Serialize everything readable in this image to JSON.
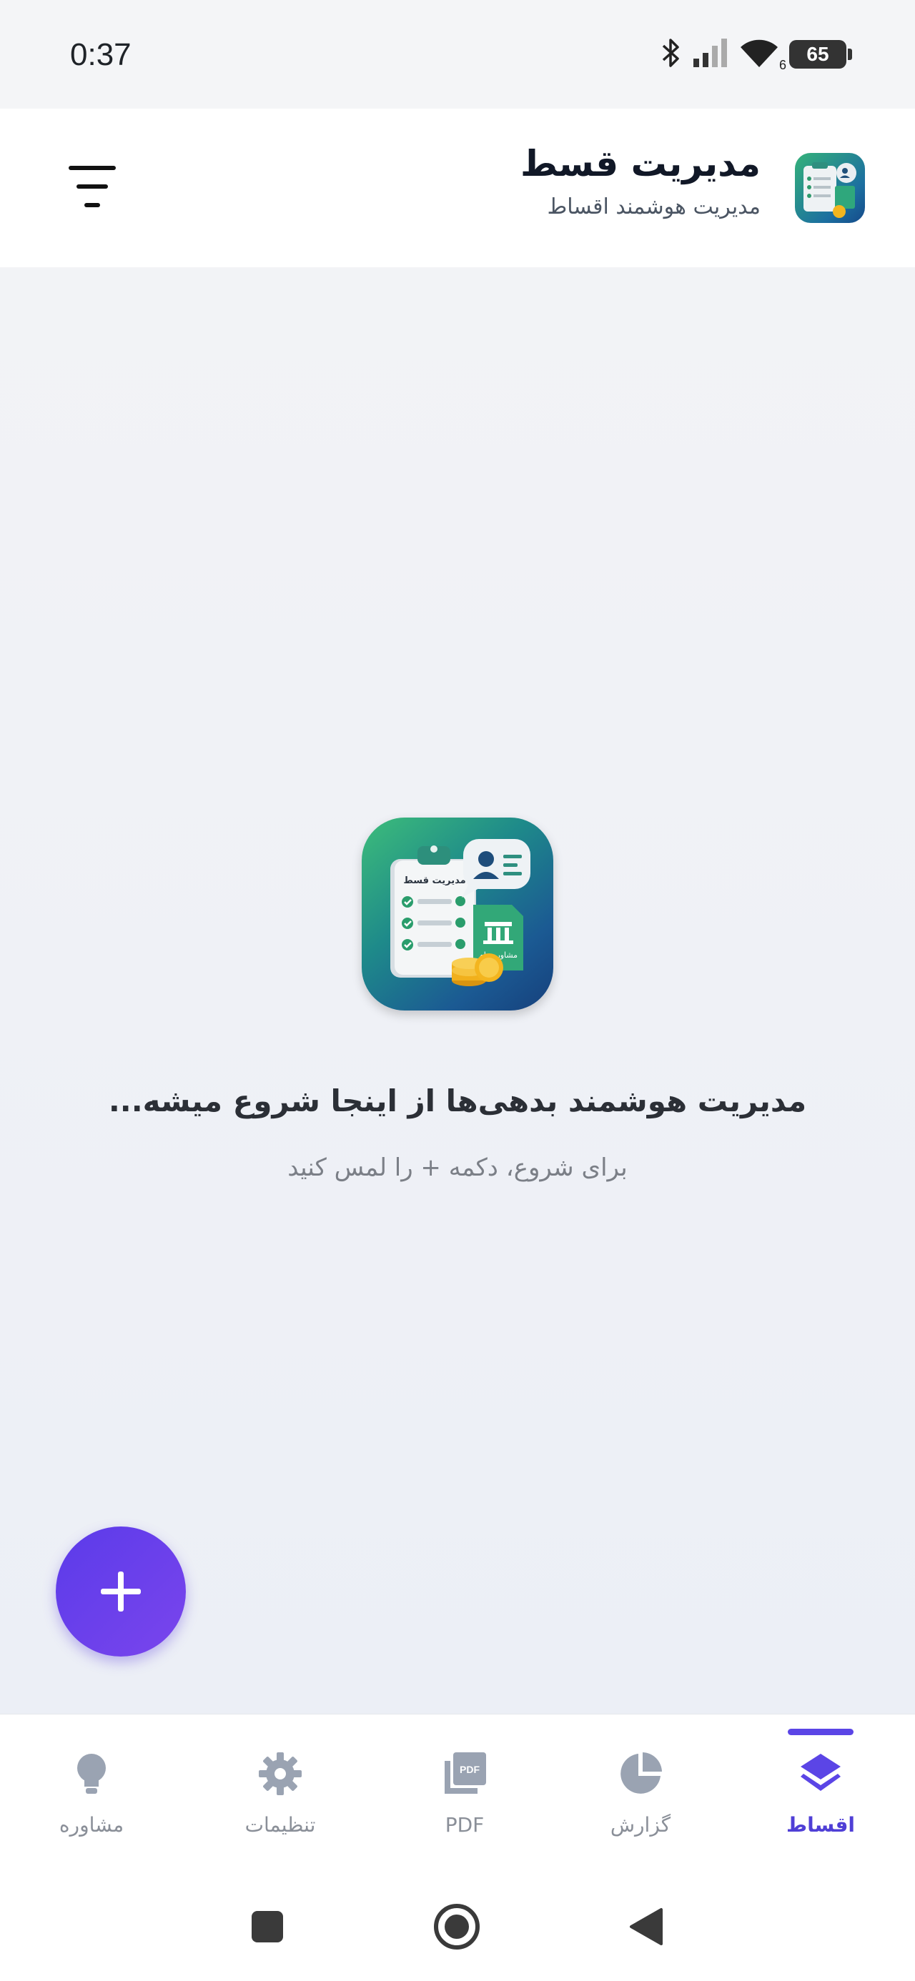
{
  "status_bar": {
    "time": "0:37",
    "battery": "65",
    "signal_label": "6"
  },
  "header": {
    "title": "مدیریت قسط",
    "subtitle": "مدیریت هوشمند اقساط"
  },
  "logo": {
    "clipboard_title": "مدیریت قسط",
    "doc_label": "مشاوره وام"
  },
  "empty_state": {
    "title": "مدیریت هوشمند بدهی‌ها از اینجا شروع میشه...",
    "hint": "برای شروع، دکمه + را لمس کنید"
  },
  "fab": {
    "label": "+"
  },
  "bottom_nav": {
    "items": [
      {
        "label": "اقساط",
        "icon": "layers-icon",
        "active": true
      },
      {
        "label": "گزارش",
        "icon": "pie-chart-icon",
        "active": false
      },
      {
        "label": "PDF",
        "icon": "pdf-icon",
        "active": false
      },
      {
        "label": "تنظیمات",
        "icon": "gear-icon",
        "active": false
      },
      {
        "label": "مشاوره",
        "icon": "lightbulb-icon",
        "active": false
      }
    ]
  },
  "colors": {
    "accent": "#5b45e6",
    "inactive": "#8a8f98",
    "fab_start": "#5b3bea",
    "fab_end": "#7a45ec"
  }
}
